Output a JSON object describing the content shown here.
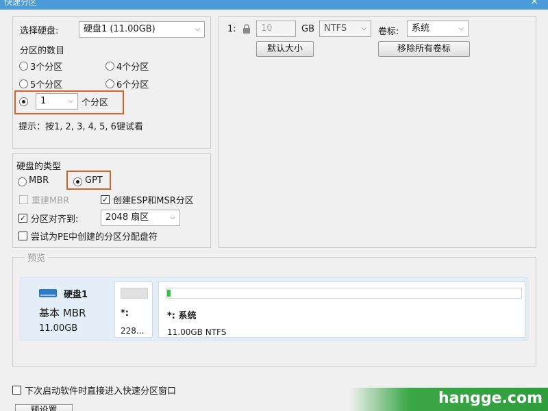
{
  "window": {
    "title": "快速分区",
    "close_glyph": "×"
  },
  "disk_select": {
    "label": "选择硬盘:",
    "value": "硬盘1 (11.00GB)"
  },
  "partition_count": {
    "label": "分区的数目",
    "options": [
      "3个分区",
      "4个分区",
      "5个分区",
      "6个分区"
    ],
    "custom_value": "1",
    "custom_suffix": "个分区",
    "hint": "提示：按1, 2, 3, 4, 5, 6键试看"
  },
  "disk_type": {
    "label": "硬盘的类型",
    "mbr": "MBR",
    "gpt": "GPT",
    "rebuild_mbr": "重建MBR",
    "create_esp_msr": "创建ESP和MSR分区",
    "align_label": "分区对齐到:",
    "align_value": "2048 扇区",
    "assign_letter": "尝试为PE中创建的分区分配盘符"
  },
  "partition_row": {
    "index": "1:",
    "size": "10",
    "unit": "GB",
    "fs": "NTFS",
    "label_label": "卷标:",
    "label_value": "系统",
    "default_size_button": "默认大小",
    "remove_labels_button": "移除所有卷标"
  },
  "preview": {
    "legend": "预览",
    "disk_name": "硬盘1",
    "disk_type": "基本 MBR",
    "disk_size": "11.00GB",
    "part1_name": "*:",
    "part1_size": "228...",
    "part2_name": "*: 系统",
    "part2_info": "11.00GB NTFS"
  },
  "footer": {
    "quick_open": "下次启动软件时直接进入快速分区窗口",
    "preset_button": "预设置",
    "watermark": "hangge.com"
  },
  "colors": {
    "highlight": "#d0622a",
    "titlebar": "#4a9bd8",
    "disk_icon": "#2f79c4",
    "usage_bar": "#33c24a"
  },
  "icons": {
    "lock": "lock-icon",
    "disk": "disk-icon",
    "dropdown": "chevron-down-icon"
  }
}
